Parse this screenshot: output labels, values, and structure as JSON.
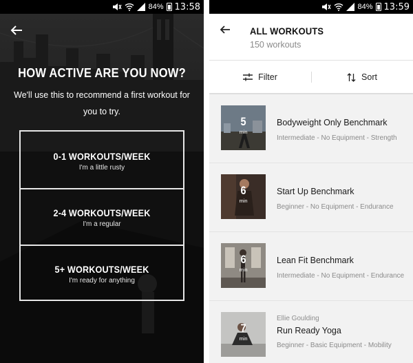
{
  "left_screen": {
    "status": {
      "battery": "84%",
      "time": "13:58"
    },
    "title": "HOW ACTIVE ARE YOU NOW?",
    "subtitle": "We'll use this to recommend a first workout for you to try.",
    "options": [
      {
        "title": "0-1 WORKOUTS/WEEK",
        "subtitle": "I'm a little rusty"
      },
      {
        "title": "2-4 WORKOUTS/WEEK",
        "subtitle": "I'm a regular"
      },
      {
        "title": "5+ WORKOUTS/WEEK",
        "subtitle": "I'm ready for anything"
      }
    ]
  },
  "right_screen": {
    "status": {
      "battery": "84%",
      "time": "13:59"
    },
    "title": "ALL WORKOUTS",
    "count": "150 workouts",
    "filter_label": "Filter",
    "sort_label": "Sort",
    "workouts": [
      {
        "minutes": "5",
        "min_label": "min",
        "author": "",
        "name": "Bodyweight Only Benchmark",
        "meta": "Intermediate - No Equipment - Strength"
      },
      {
        "minutes": "6",
        "min_label": "min",
        "author": "",
        "name": "Start Up Benchmark",
        "meta": "Beginner - No Equipment - Endurance"
      },
      {
        "minutes": "6",
        "min_label": "min",
        "author": "",
        "name": "Lean Fit Benchmark",
        "meta": "Intermediate - No Equipment - Endurance"
      },
      {
        "minutes": "7",
        "min_label": "min",
        "author": "Ellie Goulding",
        "name": "Run Ready Yoga",
        "meta": "Beginner - Basic Equipment - Mobility"
      }
    ]
  },
  "icons": [
    "back-arrow-icon",
    "filter-icon",
    "sort-icon",
    "wifi-icon",
    "signal-icon",
    "mute-icon",
    "battery-icon"
  ]
}
